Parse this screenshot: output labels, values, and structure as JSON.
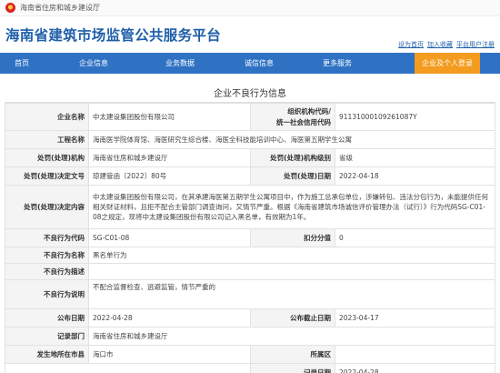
{
  "topbar": {
    "org_name": "海南省住房和城乡建设厅"
  },
  "header": {
    "title": "海南省建筑市场监管公共服务平台",
    "links": [
      "设为首页",
      "加入收藏",
      "平台用户注册"
    ]
  },
  "nav": {
    "items": [
      "首页",
      "企业信息",
      "业务数据",
      "诚信信息",
      "更多服务"
    ],
    "login_label": "企业及个人登录"
  },
  "panel": {
    "title": "企业不良行为信息"
  },
  "fields": {
    "company_name_label": "企业名称",
    "company_name": "中太建设集团股份有限公司",
    "org_code_label": "组织机构代码/",
    "credit_code_label": "统一社会信用代码",
    "org_code": "91131000109261087Y",
    "project_name_label": "工程名称",
    "project_name": "海南医学院体育馆、海医研究生综合楼、海医全科技能培训中心、海医第五期学生公寓",
    "punish_org_label": "处罚(处理)机构",
    "punish_org": "海南省住房和城乡建设厅",
    "punish_level_label": "处罚(处理)机构级别",
    "punish_level": "省级",
    "decision_doc_label": "处罚(处理)决定文号",
    "decision_doc": "琼建管函〔2022〕80号",
    "decision_date_label": "处罚(处理)日期",
    "decision_date": "2022-04-18",
    "decision_content_label": "处罚(处理)决定内容",
    "decision_content": "中太建设集团股份有限公司，在其承建海医第五期学生公寓项目中，作为施工总承包单位，涉嫌转包、违法分包行为，未能提供任何相关财证材料，且拒不配合主管部门调查询问，又情节严重。根据《海南省建筑市场诚信评价管理办法（试行）》行为代码SG-C01-08之规定，现将中太建设集团股份有限公司记入黑名单，有效期为1年。",
    "behavior_code_label": "不良行为代码",
    "behavior_code": "SG-C01-08",
    "deduct_label": "扣分分值",
    "deduct": "0",
    "behavior_name_label": "不良行为名称",
    "behavior_name": "黑名单行为",
    "behavior_desc_label": "不良行为描述",
    "behavior_desc": "",
    "behavior_detail_label": "不良行为说明",
    "behavior_detail": "不配合监督检查、逃避监管，情节严重的",
    "publish_date_label": "公布日期",
    "publish_date": "2022-04-28",
    "publish_end_label": "公布截止日期",
    "publish_end": "2023-04-17",
    "record_org_label": "记录部门",
    "record_org": "海南省住房和城乡建设厅",
    "location_label": "发生地所在市县",
    "location": "海口市",
    "region_label": "所属区",
    "region": "",
    "record_date_label": "记录日期",
    "record_date": "2022-04-28"
  }
}
